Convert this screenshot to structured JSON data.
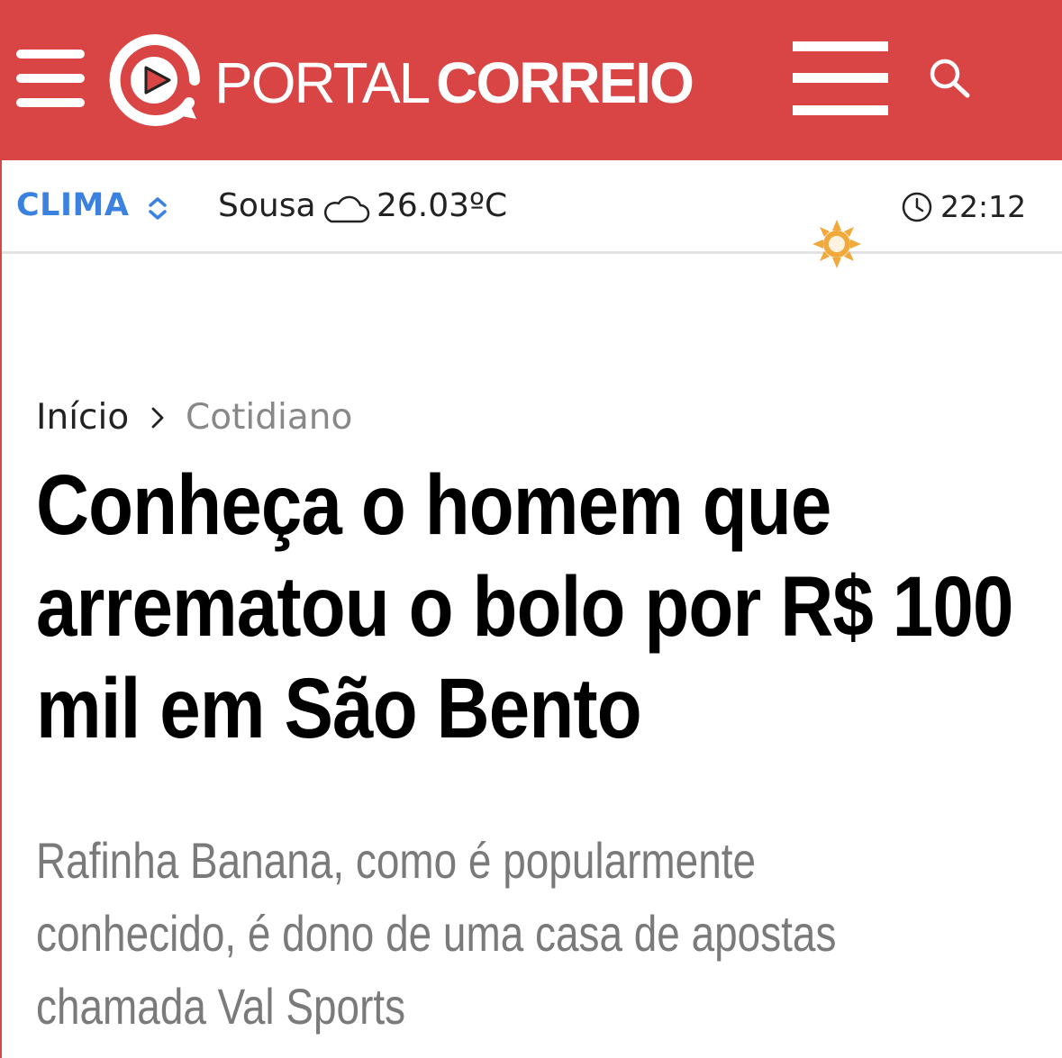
{
  "header": {
    "logo_thin": "PORTAL",
    "logo_bold": "CORREIO",
    "colors": {
      "brand": "#d94545",
      "accent": "#3b82e0"
    },
    "icons": [
      "menu-icon",
      "portal-play-logo-icon",
      "menu-bars-icon",
      "search-icon"
    ]
  },
  "weather": {
    "label": "CLIMA",
    "city": "Sousa",
    "temperature": "26.03ºC",
    "time": "22:12",
    "icons": [
      "chevron-updown-icon",
      "cloud-icon",
      "clock-icon",
      "sun-icon"
    ]
  },
  "breadcrumb": {
    "home": "Início",
    "section": "Cotidiano"
  },
  "article": {
    "headline": "Conheça o homem que arrematou o bolo por R$ 100 mil em São Bento",
    "subtitle": "Rafinha Banana, como é popularmente conhecido, é dono de uma casa de apostas chamada Val Sports"
  }
}
